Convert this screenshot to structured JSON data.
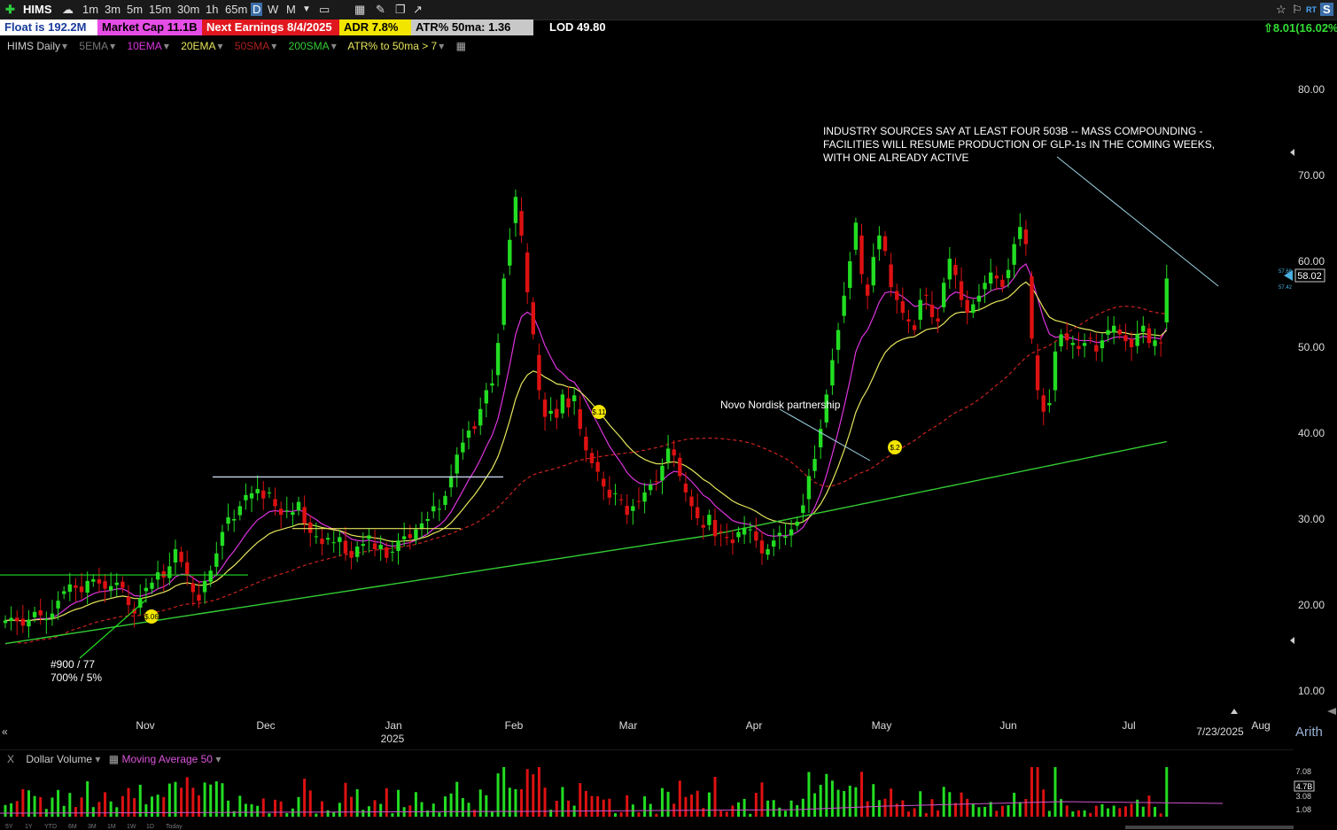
{
  "toolbar": {
    "ticker": "HIMS",
    "timeframes": [
      "1m",
      "3m",
      "5m",
      "15m",
      "30m",
      "1h",
      "65m",
      "D",
      "W",
      "M"
    ],
    "active_timeframe": "D",
    "right_icons": [
      "star-icon",
      "flag-icon",
      "rt-icon",
      "sync-icon"
    ],
    "rt_label": "RT",
    "sync_label": "S"
  },
  "infobar": {
    "float": "Float is 192.2M",
    "market_cap": "Market Cap 11.1B",
    "next_earnings": "Next Earnings 8/4/2025",
    "adr": "ADR  7.8%",
    "atr": "ATR% 50ma:  1.36",
    "lod": "LOD 49.80",
    "change": "⇧8.01(16.02%)"
  },
  "studies": {
    "symbol": "HIMS Daily",
    "ema5": "5EMA",
    "ema10": "10EMA",
    "ema20": "20EMA",
    "sma50": "50SMA",
    "sma200": "200SMA",
    "atr_rule": "ATR% to 50ma > 7"
  },
  "colors": {
    "up": "#22dd22",
    "down": "#dd1111",
    "ema10": "#dd33dd",
    "ema20": "#e6e65c",
    "sma50": "#cc2222",
    "sma200": "#33cc33"
  },
  "chart_data": {
    "type": "candlestick",
    "ylim": [
      5,
      87
    ],
    "yticks": [
      "10.00",
      "20.00",
      "30.00",
      "40.00",
      "50.00",
      "60.00",
      "70.00",
      "80.00"
    ],
    "x_month_labels": [
      "Nov",
      "Dec",
      "Jan",
      "Feb",
      "Mar",
      "Apr",
      "May",
      "Jun",
      "Jul",
      "Aug"
    ],
    "year_label": "2025",
    "last_date_label": "7/23/2025",
    "last_price_label": "58.02",
    "price_tags_small": [
      "57.68",
      "57.42"
    ],
    "annotations": [
      {
        "text": "INDUSTRY SOURCES SAY AT LEAST FOUR 503B -- MASS COMPOUNDING -"
      },
      {
        "text": "FACILITIES WILL RESUME PRODUCTION OF GLP-1s IN THE COMING WEEKS,"
      },
      {
        "text": " WITH ONE ALREADY ACTIVE"
      },
      {
        "text": "Novo Nordisk partnership"
      },
      {
        "text": "#900 / 77"
      },
      {
        "text": "700% / 5%"
      }
    ],
    "earnings_markers": [
      "$.06",
      "$.11",
      "$.2"
    ],
    "closes": [
      18.2,
      18.5,
      18.1,
      17.6,
      18.3,
      19.2,
      18.8,
      18.4,
      19.0,
      20.5,
      21.6,
      22.4,
      22.0,
      21.5,
      22.8,
      23.0,
      22.5,
      21.9,
      22.2,
      22.6,
      22.0,
      20.0,
      19.0,
      20.8,
      22.0,
      22.6,
      23.8,
      23.2,
      24.5,
      26.5,
      25.0,
      23.4,
      21.5,
      20.5,
      22.8,
      24.0,
      26.0,
      28.5,
      30.2,
      30.0,
      31.5,
      32.8,
      33.0,
      33.5,
      32.4,
      33.1,
      31.5,
      30.5,
      31.0,
      30.8,
      32.0,
      29.5,
      28.4,
      28.0,
      27.1,
      27.8,
      27.3,
      27.9,
      26.0,
      25.5,
      26.8,
      27.1,
      28.1,
      26.5,
      27.0,
      25.5,
      26.2,
      27.5,
      28.0,
      27.8,
      28.8,
      29.5,
      30.0,
      31.5,
      31.2,
      32.7,
      35.0,
      37.5,
      38.9,
      40.3,
      40.5,
      42.8,
      45.0,
      45.8,
      50.5,
      58.0,
      62.5,
      67.5,
      63.0,
      56.4,
      51.5,
      45.0,
      41.9,
      42.6,
      41.8,
      44.5,
      43.0,
      44.4,
      40.5,
      38.0,
      36.5,
      35.5,
      33.8,
      32.5,
      33.0,
      32.2,
      30.5,
      31.5,
      32.0,
      33.1,
      34.0,
      34.4,
      36.2,
      38.2,
      37.4,
      35.0,
      33.1,
      31.5,
      30.1,
      29.0,
      30.5,
      28.0,
      28.4,
      27.8,
      27.2,
      28.5,
      29.0,
      28.8,
      27.5,
      26.0,
      26.5,
      27.5,
      28.4,
      28.0,
      28.8,
      29.7,
      31.6,
      35.0,
      37.0,
      40.5,
      44.5,
      48.5,
      52.0,
      56.0,
      60.0,
      64.5,
      58.5,
      56.0,
      60.5,
      63.0,
      61.2,
      57.0,
      55.5,
      54.0,
      53.0,
      52.0,
      55.5,
      56.0,
      53.5,
      53.0,
      57.5,
      60.3,
      58.4,
      55.5,
      54.0,
      55.0,
      56.0,
      57.5,
      58.7,
      58.0,
      57.0,
      59.0,
      62.0,
      64.0,
      62.0,
      51.0,
      45.0,
      42.5,
      43.5,
      49.5,
      51.5,
      50.8,
      50.5,
      49.8,
      50.5,
      51.0,
      49.5,
      50.8,
      52.0,
      52.5,
      51.5,
      50.7,
      50.0,
      51.5,
      52.5,
      50.5,
      50.8,
      50.5,
      58.0
    ],
    "series": [
      {
        "name": "10EMA"
      },
      {
        "name": "20EMA"
      },
      {
        "name": "50SMA"
      },
      {
        "name": "200SMA"
      }
    ],
    "volume_pane": {
      "label": "Dollar Volume",
      "ma_label": "Moving Average 50",
      "yticks": [
        "7.08",
        "4.78",
        "3.08",
        "1.08"
      ],
      "current_tag": "4.7B"
    }
  },
  "bottom": {
    "scale_mode": "Arith",
    "range_labels": [
      "5Y",
      "1Y",
      "YTD",
      "6M",
      "3M",
      "1M",
      "1W",
      "1D",
      "Today"
    ]
  }
}
